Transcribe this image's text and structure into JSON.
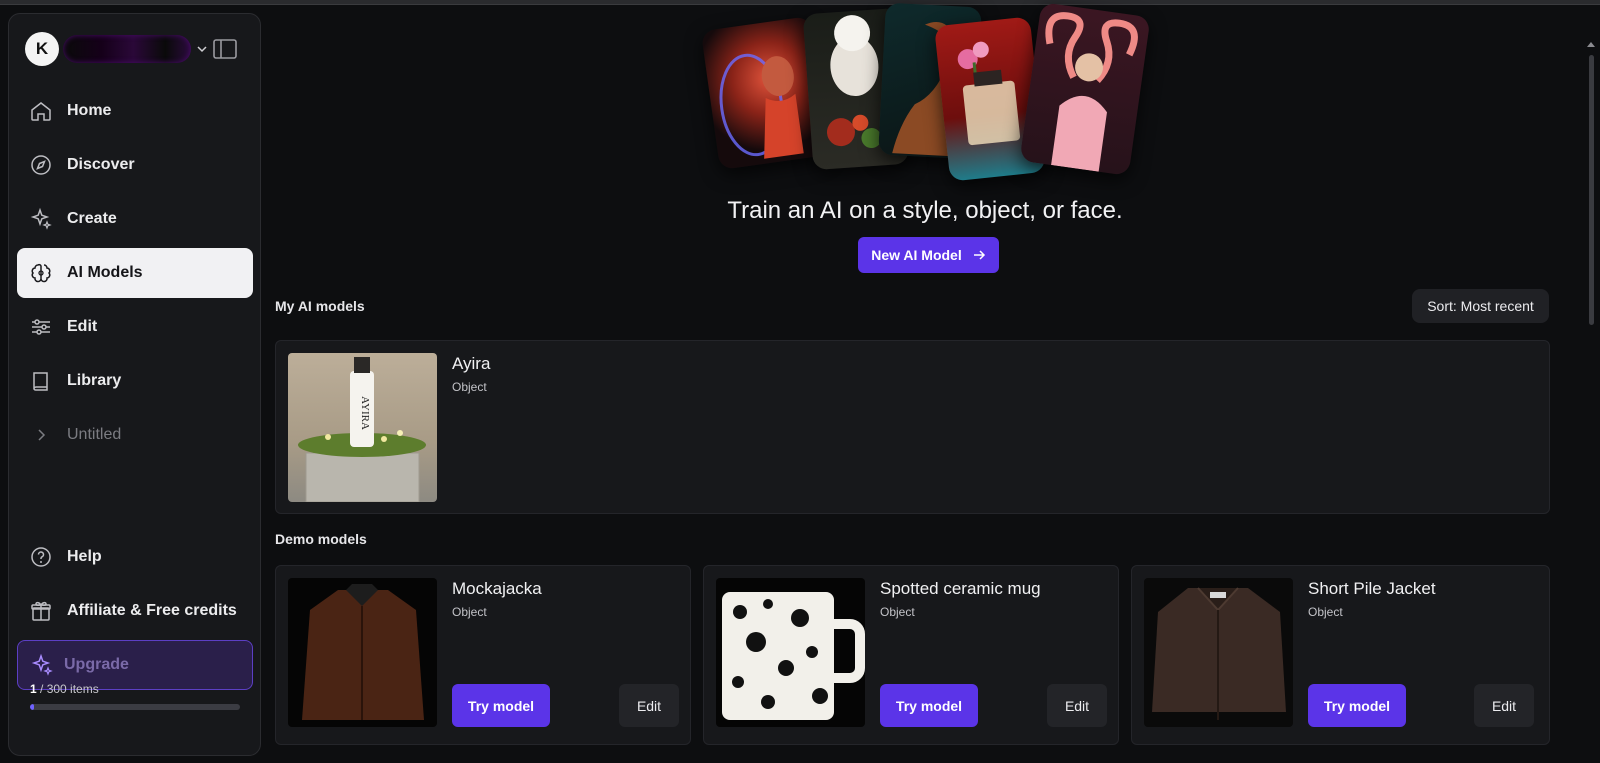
{
  "brand": {
    "logo_text": "K"
  },
  "sidebar": {
    "items": [
      {
        "label": "Home",
        "icon": "home-icon"
      },
      {
        "label": "Discover",
        "icon": "compass-icon"
      },
      {
        "label": "Create",
        "icon": "sparkle-icon"
      },
      {
        "label": "AI Models",
        "icon": "brain-icon",
        "active": true
      },
      {
        "label": "Edit",
        "icon": "sliders-icon"
      },
      {
        "label": "Library",
        "icon": "book-icon"
      },
      {
        "label": "Untitled",
        "icon": "chevron-right-icon"
      }
    ],
    "bottom": [
      {
        "label": "Help",
        "icon": "help-circle-icon"
      },
      {
        "label": "Affiliate & Free credits",
        "icon": "gift-icon"
      }
    ],
    "upgrade_label": "Upgrade",
    "items_used": "1",
    "items_total": " / 300 items",
    "usage_fraction": 0.0033
  },
  "hero": {
    "title": "Train an AI on a style, object, or face.",
    "button_label": "New AI Model"
  },
  "my_models": {
    "title": "My AI models",
    "sort_label": "Sort: Most recent",
    "items": [
      {
        "name": "Ayira",
        "type": "Object",
        "bottle_text": "AYIRA"
      }
    ]
  },
  "demo_models": {
    "title": "Demo models",
    "try_label": "Try model",
    "edit_label": "Edit",
    "items": [
      {
        "name": "Mockajacka",
        "type": "Object"
      },
      {
        "name": "Spotted ceramic mug",
        "type": "Object"
      },
      {
        "name": "Short Pile Jacket",
        "type": "Object"
      }
    ]
  },
  "colors": {
    "accent": "#5b34e8",
    "background": "#0d0e10",
    "sidebar": "#17181b"
  }
}
